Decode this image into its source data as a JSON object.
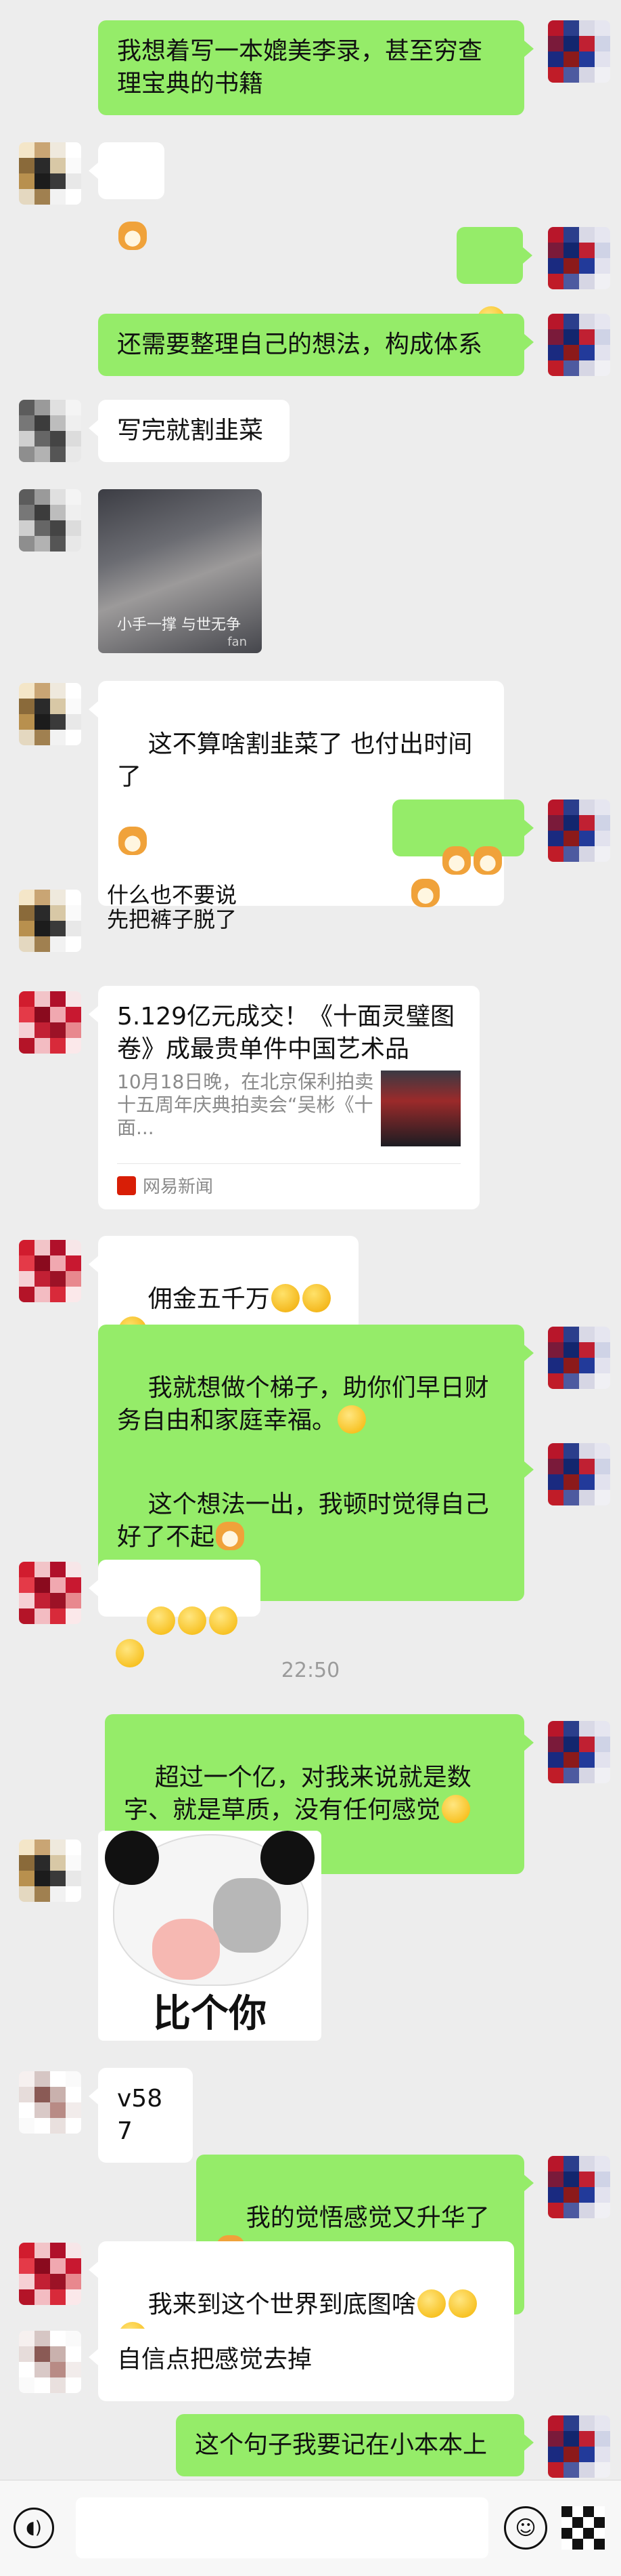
{
  "messages": {
    "m1": "我想着写一本媲美李录，甚至穷查理宝典的书籍",
    "m4": "还需要整理自己的想法，构成体系",
    "m5": "写完就割韭菜",
    "m6_caption": "小手一撑 与世无争",
    "m6_watermark": "fan",
    "m7": "这不算啥割韭菜了 也付出时间了",
    "m9_line1": "什么也不要说",
    "m9_line2": "先把裤子脱了",
    "m11": "佣金五千万",
    "m12": "我就想做个梯子，助你们早日财务自由和家庭幸福。",
    "m13": "这个想法一出，我顿时觉得自己好了不起",
    "m15": "超过一个亿，对我来说就是数字、就是草质，没有任何感觉",
    "m16_caption": "比个你",
    "m17": "v587",
    "m18": "我的觉悟感觉又升华了",
    "m19": "我来到这个世界到底图啥",
    "m20": "自信点把感觉去掉",
    "m21": "这个句子我要记在小本本上"
  },
  "card": {
    "title": "5.129亿元成交！《十面灵璧图卷》成最贵单件中国艺术品",
    "desc": "10月18日晚，在北京保利拍卖十五周年庆典拍卖会“吴彬《十面...",
    "source": "网易新闻"
  },
  "timestamp": "22:50",
  "icons": {
    "shiba": "shiba-dog-emoji",
    "smirk": "smirk-emoji",
    "laugh": "laughing-emoji",
    "grin": "grinning-emoji",
    "silly": "silly-face-emoji",
    "voice": "voice-icon",
    "emoji": "emoji-icon",
    "more": "more-icon"
  },
  "colors": {
    "sent_bubble": "#95ec69",
    "received_bubble": "#ffffff",
    "background": "#ededed"
  }
}
